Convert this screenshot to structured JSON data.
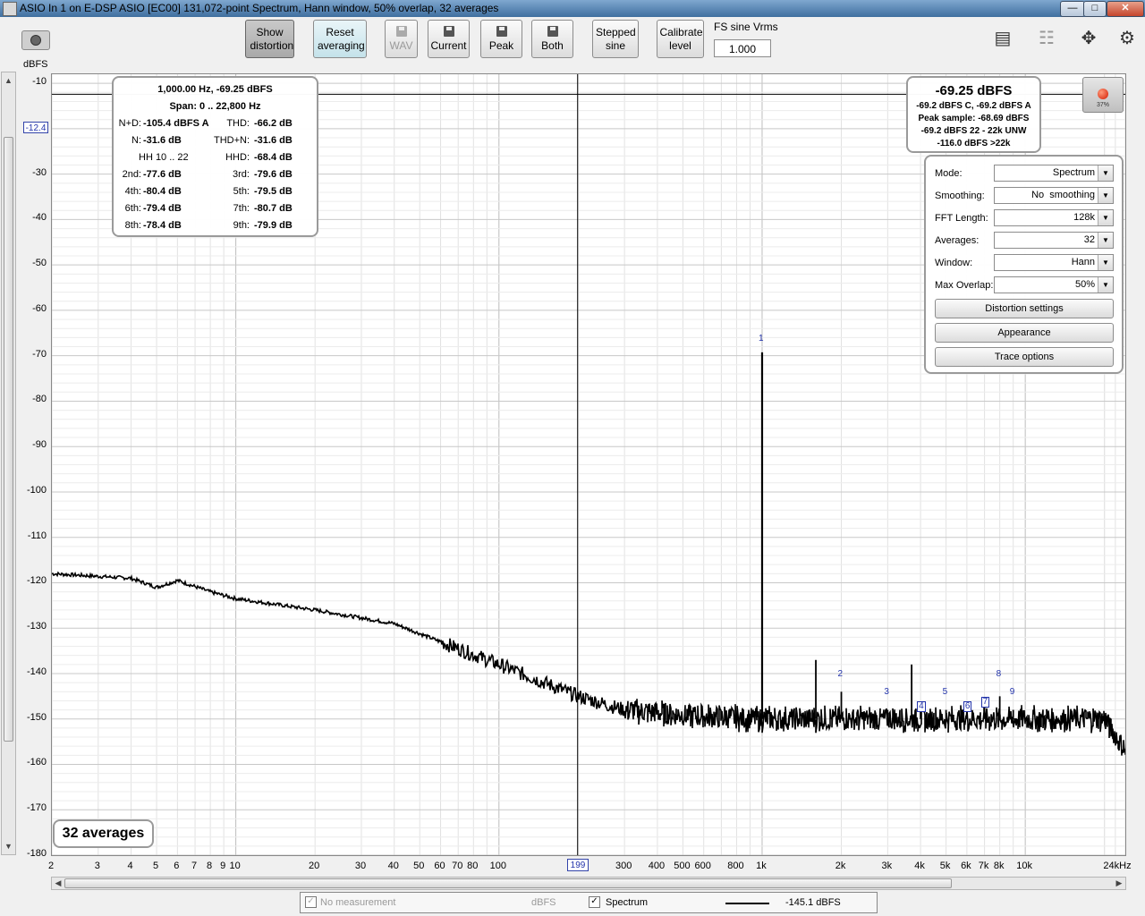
{
  "window": {
    "title": "ASIO In 1 on E-DSP ASIO [EC00] 131,072-point Spectrum, Hann window, 50% overlap, 32 averages"
  },
  "toolbar": {
    "show_distortion": "Show distortion",
    "reset_averaging": "Reset averaging",
    "wav": "WAV",
    "current": "Current",
    "peak": "Peak",
    "both": "Both",
    "stepped_sine": "Stepped sine",
    "calibrate_level": "Calibrate level",
    "fs_label": "FS sine Vrms",
    "fs_value": "1.000"
  },
  "y_axis": {
    "unit": "dBFS",
    "marker": "-12.4",
    "ticks": [
      "-10",
      "-20",
      "-30",
      "-40",
      "-50",
      "-60",
      "-70",
      "-80",
      "-90",
      "-100",
      "-110",
      "-120",
      "-130",
      "-140",
      "-150",
      "-160",
      "-170",
      "-180"
    ]
  },
  "x_axis": {
    "marker": "199",
    "ticks": [
      "2",
      "3",
      "4",
      "5",
      "6",
      "7",
      "8",
      "9",
      "10",
      "20",
      "30",
      "40",
      "50",
      "60",
      "70",
      "80",
      "100",
      "300",
      "400",
      "500",
      "600",
      "800",
      "1k",
      "2k",
      "3k",
      "4k",
      "5k",
      "6k",
      "7k",
      "8k",
      "10k",
      "24kHz"
    ]
  },
  "distortion": {
    "line1": "1,000.00 Hz, -69.25 dBFS",
    "line2": "Span: 0 .. 22,800 Hz",
    "rows": [
      [
        {
          "l": "N+D:",
          "v": "-105.4 dBFS A"
        },
        {
          "l": "THD:",
          "v": "-66.2 dB"
        }
      ],
      [
        {
          "l": "N:",
          "v": "-31.6 dB"
        },
        {
          "l": "THD+N:",
          "v": "-31.6 dB"
        }
      ],
      [
        {
          "l": "HH 10 .. 22",
          "v": ""
        },
        {
          "l": "HHD:",
          "v": "-68.4 dB"
        }
      ],
      [
        {
          "l": "2nd:",
          "v": "-77.6 dB"
        },
        {
          "l": "3rd:",
          "v": "-79.6 dB"
        }
      ],
      [
        {
          "l": "4th:",
          "v": "-80.4 dB"
        },
        {
          "l": "5th:",
          "v": "-79.5 dB"
        }
      ],
      [
        {
          "l": "6th:",
          "v": "-79.4 dB"
        },
        {
          "l": "7th:",
          "v": "-80.7 dB"
        }
      ],
      [
        {
          "l": "8th:",
          "v": "-78.4 dB"
        },
        {
          "l": "9th:",
          "v": "-79.9 dB"
        }
      ]
    ]
  },
  "level": {
    "main": "-69.25 dBFS",
    "l1": "-69.2 dBFS C, -69.2 dBFS A",
    "l2": "Peak sample: -68.69 dBFS",
    "l3": "-69.2 dBFS 22 - 22k UNW",
    "l4": "-116.0 dBFS >22k"
  },
  "record": {
    "percent": "37%"
  },
  "settings": {
    "mode": {
      "label": "Mode:",
      "value": "Spectrum"
    },
    "smoothing": {
      "label": "Smoothing:",
      "value": "No  smoothing"
    },
    "fft": {
      "label": "FFT Length:",
      "value": "128k"
    },
    "averages": {
      "label": "Averages:",
      "value": "32"
    },
    "window": {
      "label": "Window:",
      "value": "Hann"
    },
    "overlap": {
      "label": "Max Overlap:",
      "value": "50%"
    },
    "distortion_settings": "Distortion settings",
    "appearance": "Appearance",
    "trace_options": "Trace options"
  },
  "averages_badge": "32 averages",
  "harmonic_labels": [
    "1",
    "2",
    "3",
    "4",
    "5",
    "6",
    "7",
    "8",
    "9"
  ],
  "legend": {
    "no_measurement": "No measurement",
    "unit": "dBFS",
    "spectrum": "Spectrum",
    "spectrum_value": "-145.1 dBFS"
  },
  "chart_data": {
    "type": "line",
    "xscale": "log",
    "xlim": [
      2,
      24000
    ],
    "ylim": [
      -180,
      -8
    ],
    "xlabel": "",
    "ylabel": "dBFS",
    "series": [
      {
        "name": "Spectrum",
        "color": "#000000",
        "noise_floor": [
          [
            2,
            -118
          ],
          [
            4,
            -119
          ],
          [
            5,
            -121
          ],
          [
            6,
            -119.5
          ],
          [
            8,
            -122
          ],
          [
            10,
            -123.5
          ],
          [
            20,
            -126
          ],
          [
            40,
            -129
          ],
          [
            60,
            -133
          ],
          [
            100,
            -138
          ],
          [
            200,
            -145
          ],
          [
            300,
            -148
          ],
          [
            600,
            -149.5
          ],
          [
            1000,
            -150
          ],
          [
            5000,
            -150
          ],
          [
            20000,
            -150
          ],
          [
            24000,
            -157
          ]
        ],
        "peaks": [
          [
            1000,
            -69.25
          ],
          [
            1600,
            -137
          ],
          [
            2000,
            -144
          ],
          [
            3000,
            -148
          ],
          [
            3700,
            -138
          ],
          [
            4000,
            -148
          ],
          [
            5000,
            -148
          ],
          [
            6000,
            -147
          ],
          [
            7000,
            -147
          ],
          [
            8000,
            -145
          ],
          [
            9000,
            -148
          ]
        ]
      }
    ]
  }
}
